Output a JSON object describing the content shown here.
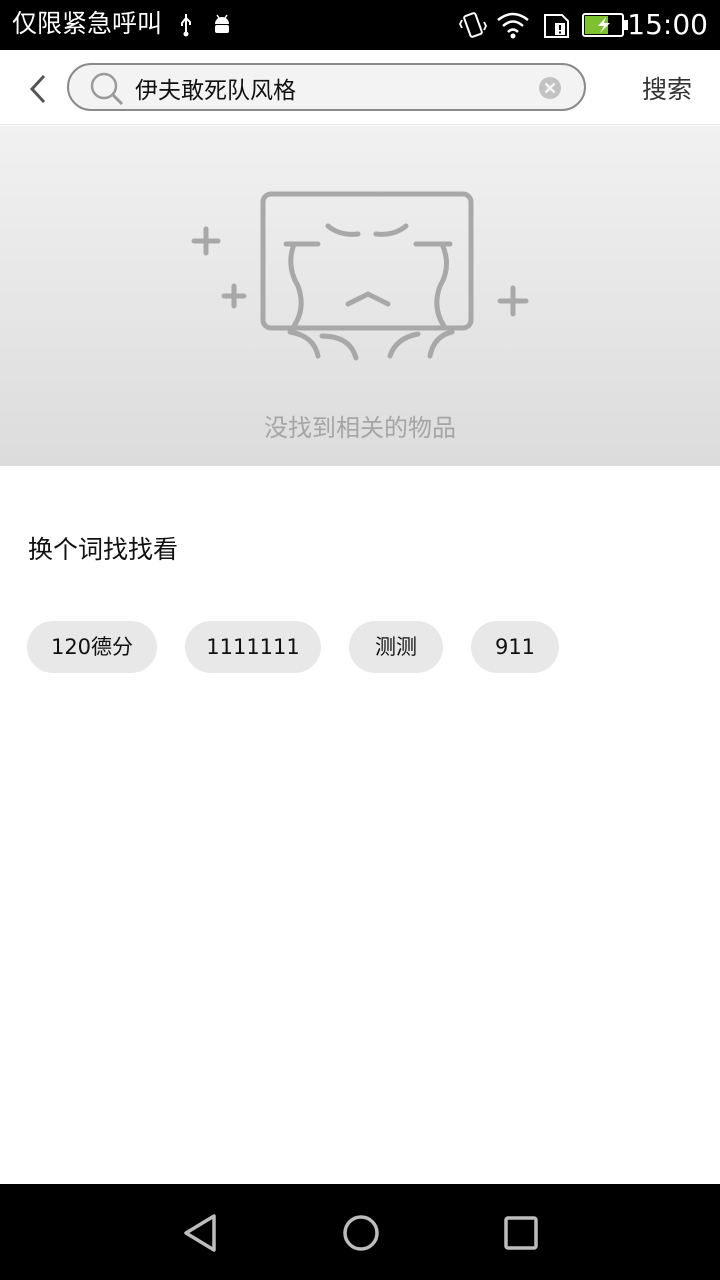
{
  "status_bar": {
    "carrier_text": "仅限紧急呼叫",
    "time": "15:00",
    "icons": [
      "usb-icon",
      "android-debug-icon",
      "vibrate-icon",
      "wifi-icon",
      "sim-alert-icon",
      "battery-charging-icon"
    ]
  },
  "header": {
    "search_value": "伊夫敢死队风格",
    "search_button": "搜索"
  },
  "empty_state": {
    "message": "没找到相关的物品"
  },
  "suggestions": {
    "title": "换个词找找看",
    "chips": [
      {
        "label": "120德分"
      },
      {
        "label": "1111111"
      },
      {
        "label": "测测"
      },
      {
        "label": "911"
      }
    ]
  },
  "colors": {
    "status_bar_bg": "#000000",
    "chip_bg": "#e8e8e8",
    "illustration": "#a8a8a8"
  }
}
